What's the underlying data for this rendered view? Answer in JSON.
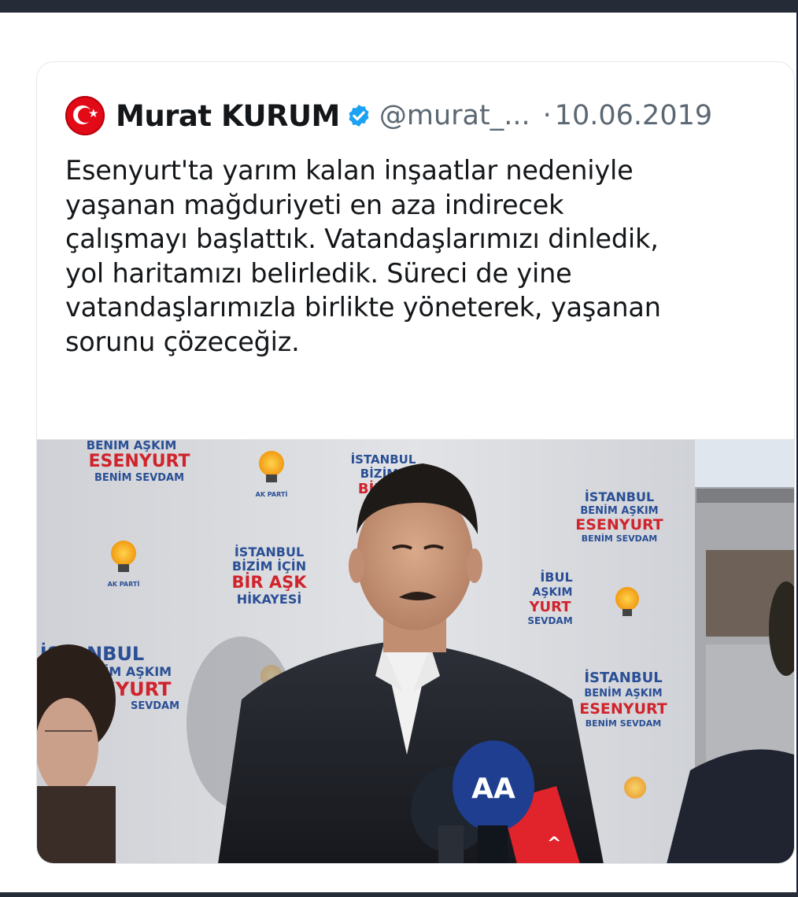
{
  "tweet": {
    "author_name": "Murat KURUM",
    "handle": "@murat_...",
    "separator": "·",
    "date": "10.06.2019",
    "text": "Esenyurt'ta yarım kalan inşaatlar nedeniyle\nyaşanan mağduriyeti en aza indirecek\nçalışmayı başlattık. Vatandaşlarımızı dinledik,\nyol haritamızı belirledik.  Süreci de yine\nvatandaşlarımızla birlikte yöneterek, yaşanan\nsorunu çözeceğiz.",
    "icons": {
      "avatar": "turkish-flag-avatar",
      "verified": "verified-badge-icon"
    }
  },
  "media": {
    "backdrop_texts": [
      "BENİM AŞKIM",
      "ESENYURT",
      "BENİM SEVDAM",
      "İSTANBUL",
      "BİZİM İÇİN",
      "BİR AŞK",
      "HİKAYESİ",
      "AK PARTİ",
      "ESENYURT",
      "İSTANBUL",
      "BENİM AŞKIM",
      "ESENYURT",
      "BENİM SEVDAM"
    ],
    "microphone_logo": "AA"
  },
  "colors": {
    "frame": "#262b38",
    "text": "#14171a",
    "muted": "#5b6772",
    "verified": "#1da1f2",
    "flag_red": "#e30a17",
    "ak_orange": "#f7a21b",
    "backdrop_blue": "#2a4f95",
    "backdrop_red": "#d0232b"
  }
}
